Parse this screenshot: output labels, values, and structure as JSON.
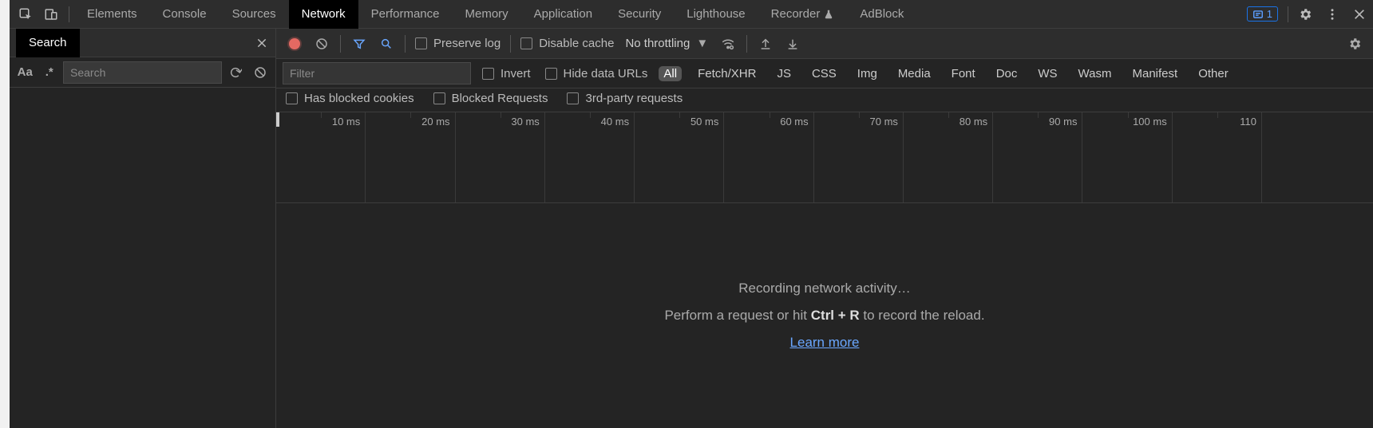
{
  "tabs": {
    "items": [
      "Elements",
      "Console",
      "Sources",
      "Network",
      "Performance",
      "Memory",
      "Application",
      "Security",
      "Lighthouse",
      "Recorder",
      "AdBlock"
    ],
    "active": "Network",
    "beta_index": 9
  },
  "issues_count": "1",
  "search_drawer": {
    "tab_label": "Search",
    "match_case_label": "Aa",
    "regex_label": ".*",
    "placeholder": "Search"
  },
  "network_toolbar": {
    "preserve_log": "Preserve log",
    "disable_cache": "Disable cache",
    "throttling": "No throttling"
  },
  "filterbar": {
    "filter_placeholder": "Filter",
    "invert": "Invert",
    "hide_data_urls": "Hide data URLs",
    "types": [
      "All",
      "Fetch/XHR",
      "JS",
      "CSS",
      "Img",
      "Media",
      "Font",
      "Doc",
      "WS",
      "Wasm",
      "Manifest",
      "Other"
    ],
    "active_type": "All",
    "blocked_cookies": "Has blocked cookies",
    "blocked_requests": "Blocked Requests",
    "third_party": "3rd-party requests"
  },
  "timeline": {
    "ticks": [
      "10 ms",
      "20 ms",
      "30 ms",
      "40 ms",
      "50 ms",
      "60 ms",
      "70 ms",
      "80 ms",
      "90 ms",
      "100 ms",
      "110"
    ]
  },
  "empty": {
    "line1": "Recording network activity…",
    "line2_pre": "Perform a request or hit ",
    "line2_kbd": "Ctrl + R",
    "line2_post": " to record the reload.",
    "link": "Learn more"
  }
}
